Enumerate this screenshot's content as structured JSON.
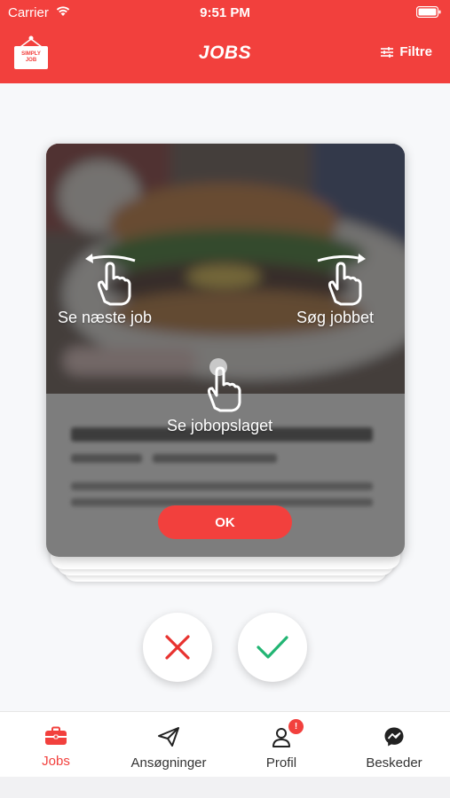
{
  "status_bar": {
    "carrier": "Carrier",
    "time": "9:51 PM"
  },
  "header": {
    "logo_text_line1": "SIMPLY",
    "logo_text_line2": "JOB",
    "title": "JOBS",
    "filter_label": "Filtre"
  },
  "tutorial": {
    "swipe_left_label": "Se næste job",
    "swipe_right_label": "Søg jobbet",
    "tap_label": "Se jobopslaget",
    "ok_label": "OK"
  },
  "actions": {
    "reject_icon": "x-icon",
    "accept_icon": "check-icon"
  },
  "tabs": [
    {
      "label": "Jobs",
      "icon": "briefcase-icon",
      "active": true
    },
    {
      "label": "Ansøgninger",
      "icon": "paper-plane-icon",
      "active": false
    },
    {
      "label": "Profil",
      "icon": "person-icon",
      "active": false,
      "badge": "!"
    },
    {
      "label": "Beskeder",
      "icon": "messenger-icon",
      "active": false
    }
  ],
  "colors": {
    "brand_red": "#f2403d",
    "accept_green": "#22b573",
    "reject_red": "#e8322f"
  }
}
